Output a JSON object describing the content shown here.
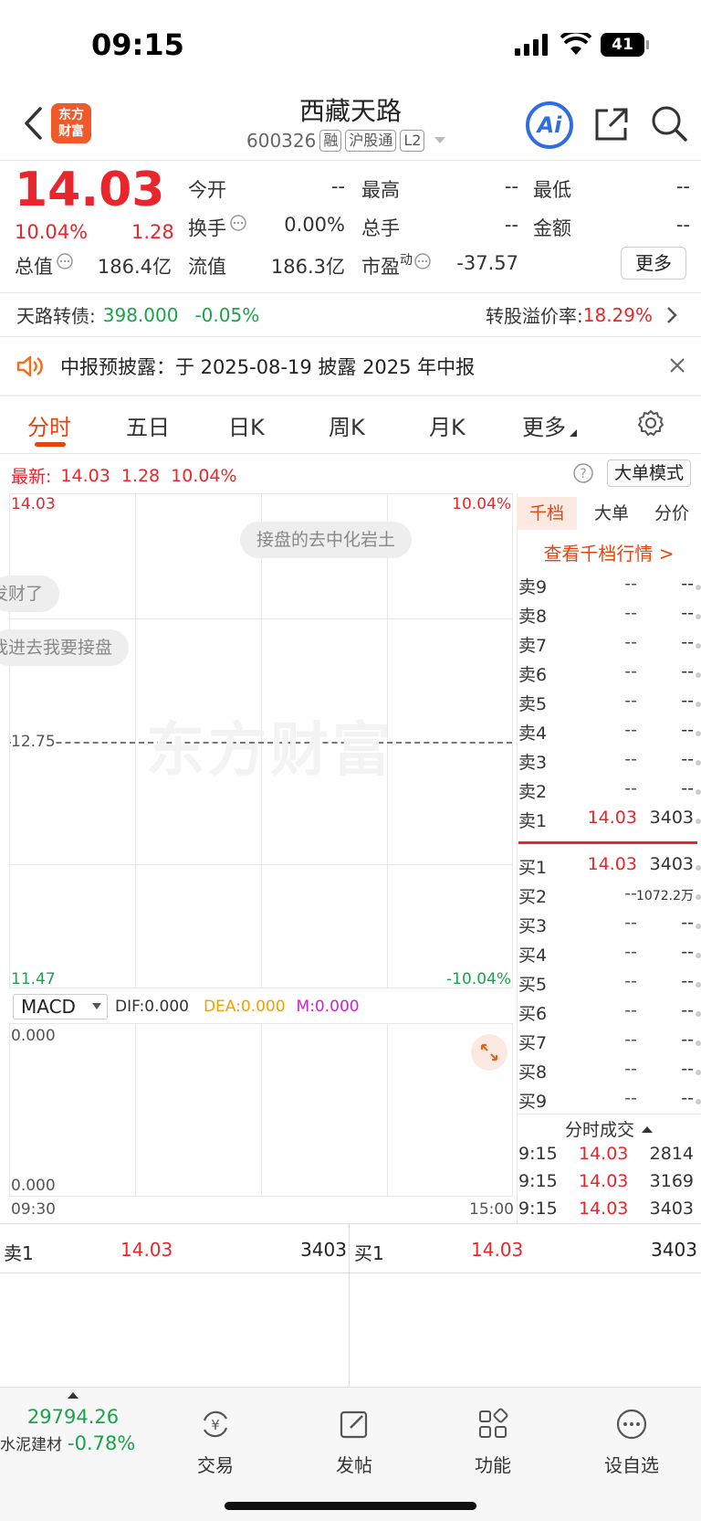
{
  "status": {
    "time": "09:15",
    "battery": "41"
  },
  "header": {
    "logo_line1": "东方",
    "logo_line2": "财富",
    "title": "西藏天路",
    "code": "600326",
    "tags": [
      "融",
      "沪股通",
      "L2"
    ],
    "ai_label": "Ai"
  },
  "quote": {
    "price": "14.03",
    "change_pct": "10.04%",
    "change": "1.28",
    "open_label": "今开",
    "open": "--",
    "high_label": "最高",
    "high": "--",
    "low_label": "最低",
    "low": "--",
    "turnover_label": "换手",
    "turnover": "0.00%",
    "volume_label": "总手",
    "volume": "--",
    "amount_label": "金额",
    "amount": "--",
    "mktcap_label": "总值",
    "mktcap": "186.4亿",
    "float_label": "流值",
    "float": "186.3亿",
    "pe_label": "市盈",
    "pe_sup": "动",
    "pe": "-37.57",
    "more": "更多"
  },
  "bond": {
    "name": "天路转债:",
    "price": "398.000",
    "change": "-0.05%",
    "premium_label": "转股溢价率:",
    "premium": "18.29%"
  },
  "notice": {
    "text": "中报预披露：于 2025-08-19 披露 2025 年中报"
  },
  "tabs": [
    "分时",
    "五日",
    "日K",
    "周K",
    "月K",
    "更多"
  ],
  "chart": {
    "latest_label": "最新:",
    "latest_price": "14.03",
    "latest_change": "1.28",
    "latest_pct": "10.04%",
    "big_order_mode": "大单模式",
    "top_price": "14.03",
    "top_pct": "10.04%",
    "mid_price": "12.75",
    "bottom_price": "11.47",
    "bottom_pct": "-10.04%",
    "time_start": "09:30",
    "time_end": "15:00",
    "bubbles": [
      "接盘的去中化岩土",
      "发财了",
      "我进去我要接盘"
    ],
    "watermark": "东方财富"
  },
  "macd": {
    "label": "MACD",
    "dif": "DIF:0.000",
    "dea": "DEA:0.000",
    "m": "M:0.000",
    "top": "0.000",
    "bottom": "0.000"
  },
  "orderbook": {
    "tabs": [
      "千档",
      "大单",
      "分价"
    ],
    "link": "查看千档行情 >",
    "sells": [
      {
        "label": "卖9",
        "price": "--",
        "vol": "--"
      },
      {
        "label": "卖8",
        "price": "--",
        "vol": "--"
      },
      {
        "label": "卖7",
        "price": "--",
        "vol": "--"
      },
      {
        "label": "卖6",
        "price": "--",
        "vol": "--"
      },
      {
        "label": "卖5",
        "price": "--",
        "vol": "--"
      },
      {
        "label": "卖4",
        "price": "--",
        "vol": "--"
      },
      {
        "label": "卖3",
        "price": "--",
        "vol": "--"
      },
      {
        "label": "卖2",
        "price": "--",
        "vol": "--"
      },
      {
        "label": "卖1",
        "price": "14.03",
        "vol": "3403"
      }
    ],
    "buys": [
      {
        "label": "买1",
        "price": "14.03",
        "vol": "3403"
      },
      {
        "label": "买2",
        "price": "--",
        "vol": "1072.2万"
      },
      {
        "label": "买3",
        "price": "--",
        "vol": "--"
      },
      {
        "label": "买4",
        "price": "--",
        "vol": "--"
      },
      {
        "label": "买5",
        "price": "--",
        "vol": "--"
      },
      {
        "label": "买6",
        "price": "--",
        "vol": "--"
      },
      {
        "label": "买7",
        "price": "--",
        "vol": "--"
      },
      {
        "label": "买8",
        "price": "--",
        "vol": "--"
      },
      {
        "label": "买9",
        "price": "--",
        "vol": "--"
      }
    ],
    "trades_title": "分时成交",
    "trades": [
      {
        "time": "9:15",
        "price": "14.03",
        "vol": "2814"
      },
      {
        "time": "9:15",
        "price": "14.03",
        "vol": "3169"
      },
      {
        "time": "9:15",
        "price": "14.03",
        "vol": "3403"
      }
    ]
  },
  "bottom_book": {
    "sell_label": "卖1",
    "sell_price": "14.03",
    "sell_vol": "3403",
    "buy_label": "买1",
    "buy_price": "14.03",
    "buy_vol": "3403"
  },
  "nav": {
    "index_value": "29794.26",
    "index_name": "水泥建材",
    "index_change": "-0.78%",
    "items": [
      "交易",
      "发帖",
      "功能",
      "设自选"
    ]
  },
  "colors": {
    "up": "#e8262b",
    "down": "#1aa34a",
    "accent": "#e8440e",
    "ai": "#2f6ee0"
  }
}
